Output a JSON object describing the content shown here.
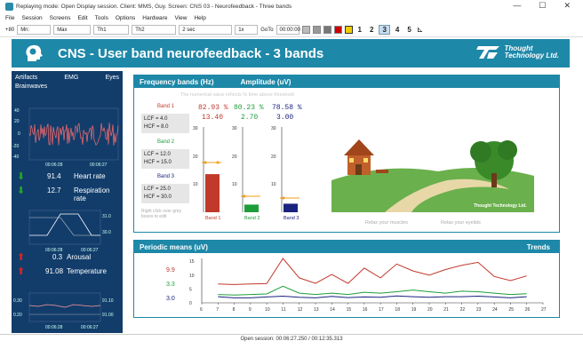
{
  "window": {
    "title": "Replaying mode: Open Display session. Client: MMS, Guy. Screen: CNS 03 - Neurofeedback - Three bands",
    "controls": [
      "—",
      "☐",
      "✕"
    ]
  },
  "menu": [
    "File",
    "Session",
    "Screens",
    "Edit",
    "Tools",
    "Options",
    "Hardware",
    "View",
    "Help"
  ],
  "toolbar": {
    "db_label": "+80",
    "mn": "Mn:",
    "max": "Max",
    "th1": "Th1",
    "th2": "Th2",
    "time": "2 sec",
    "speed": "1x",
    "goto": "GoTo",
    "goto_val": "00:00:00",
    "pages": [
      "1",
      "2",
      "3",
      "4",
      "5"
    ],
    "selected_page": "3"
  },
  "banner": {
    "title": "CNS - User band neurofeedback - 3 bands",
    "logo_line1": "Thought",
    "logo_line2": "Technology Ltd."
  },
  "left": {
    "tabs": [
      "Artifacts",
      "EMG",
      "Eyes"
    ],
    "brainwaves": "Brainwaves",
    "eeg_axis": [
      "40",
      "20",
      "0",
      "-20",
      "-40"
    ],
    "time_start": "00:06:28",
    "time_end": "00:06:27",
    "heart_value": "91.4",
    "heart_label": "Heart rate",
    "resp_value": "12.7",
    "resp_label": "Respiration rate",
    "resp_axis_top": "31.0",
    "resp_axis_bot": "30.0",
    "arousal_value": "0.3",
    "arousal_label": "Arousal",
    "temp_value": "91.08",
    "temp_label": "Temperature",
    "temp_axis_top": "91.10",
    "temp_axis_mid": "91.00",
    "temp_left_top": "0.30",
    "temp_left_bot": "0.20"
  },
  "freq_panel": {
    "title": "Frequency bands (Hz)",
    "title2": "Amplitude (uV)",
    "hint": "The numerical value reflects % time above threshold",
    "bands": [
      {
        "name": "Band 1",
        "lcf": "LCF = 4.0",
        "hcf": "HCF = 8.0",
        "pct": "82.93 %",
        "amp": "13.40",
        "color": "#c0392b"
      },
      {
        "name": "Band 2",
        "lcf": "LCF = 12.0",
        "hcf": "HCF = 15.0",
        "pct": "80.23 %",
        "amp": "2.70",
        "color": "#1e9e3a"
      },
      {
        "name": "Band 3",
        "lcf": "LCF = 25.0",
        "hcf": "HCF = 30.0",
        "pct": "78.58 %",
        "amp": "3.00",
        "color": "#1a237e"
      }
    ],
    "note": "Right click over grey boxes to edit",
    "axis_top": "30",
    "axis_mid": "20",
    "axis_low": "10",
    "axis_zero": "0",
    "relax1": "Relax your muscles",
    "relax2": "Relax your eyelids",
    "scene_logo": "Thought Technology Ltd."
  },
  "periodic": {
    "title": "Periodic means (uV)",
    "trends": "Trends",
    "labels": [
      "9.9",
      "3.3",
      "3.0"
    ],
    "label_colors": [
      "#c0392b",
      "#1e9e3a",
      "#1a237e"
    ],
    "y_ticks": [
      "15",
      "10",
      "5",
      "0"
    ],
    "x_ticks": [
      "6",
      "7",
      "8",
      "9",
      "10",
      "11",
      "12",
      "13",
      "14",
      "15",
      "16",
      "17",
      "18",
      "19",
      "20",
      "21",
      "22",
      "23",
      "24",
      "25",
      "26",
      "27"
    ]
  },
  "chart_data": {
    "type": "line",
    "x": [
      7,
      8,
      9,
      10,
      11,
      12,
      13,
      14,
      15,
      16,
      17,
      18,
      19,
      20,
      21,
      22,
      23,
      24,
      25,
      26
    ],
    "series": [
      {
        "name": "Band 1",
        "values": [
          6.8,
          6.6,
          6.8,
          6.9,
          16.0,
          9.0,
          7.0,
          10.2,
          7.0,
          12.5,
          9.0,
          14.0,
          11.5,
          10.0,
          12.0,
          13.5,
          14.6,
          9.5,
          8.0,
          9.7
        ]
      },
      {
        "name": "Band 2",
        "values": [
          3.0,
          2.8,
          3.0,
          3.2,
          6.0,
          3.5,
          3.0,
          3.5,
          3.0,
          3.8,
          3.5,
          4.0,
          4.6,
          4.0,
          3.5,
          4.2,
          4.0,
          3.5,
          3.0,
          3.3
        ]
      },
      {
        "name": "Band 3",
        "values": [
          2.2,
          1.8,
          1.8,
          2.1,
          2.4,
          2.0,
          1.8,
          2.3,
          1.9,
          2.1,
          2.0,
          2.5,
          2.2,
          2.0,
          2.2,
          2.2,
          2.4,
          2.1,
          1.8,
          2.2
        ]
      }
    ],
    "ylim": [
      0,
      16
    ],
    "xlim": [
      6,
      27
    ]
  },
  "footer": {
    "text": "Open session: 00:06:27.250 / 00:12:35.313"
  }
}
